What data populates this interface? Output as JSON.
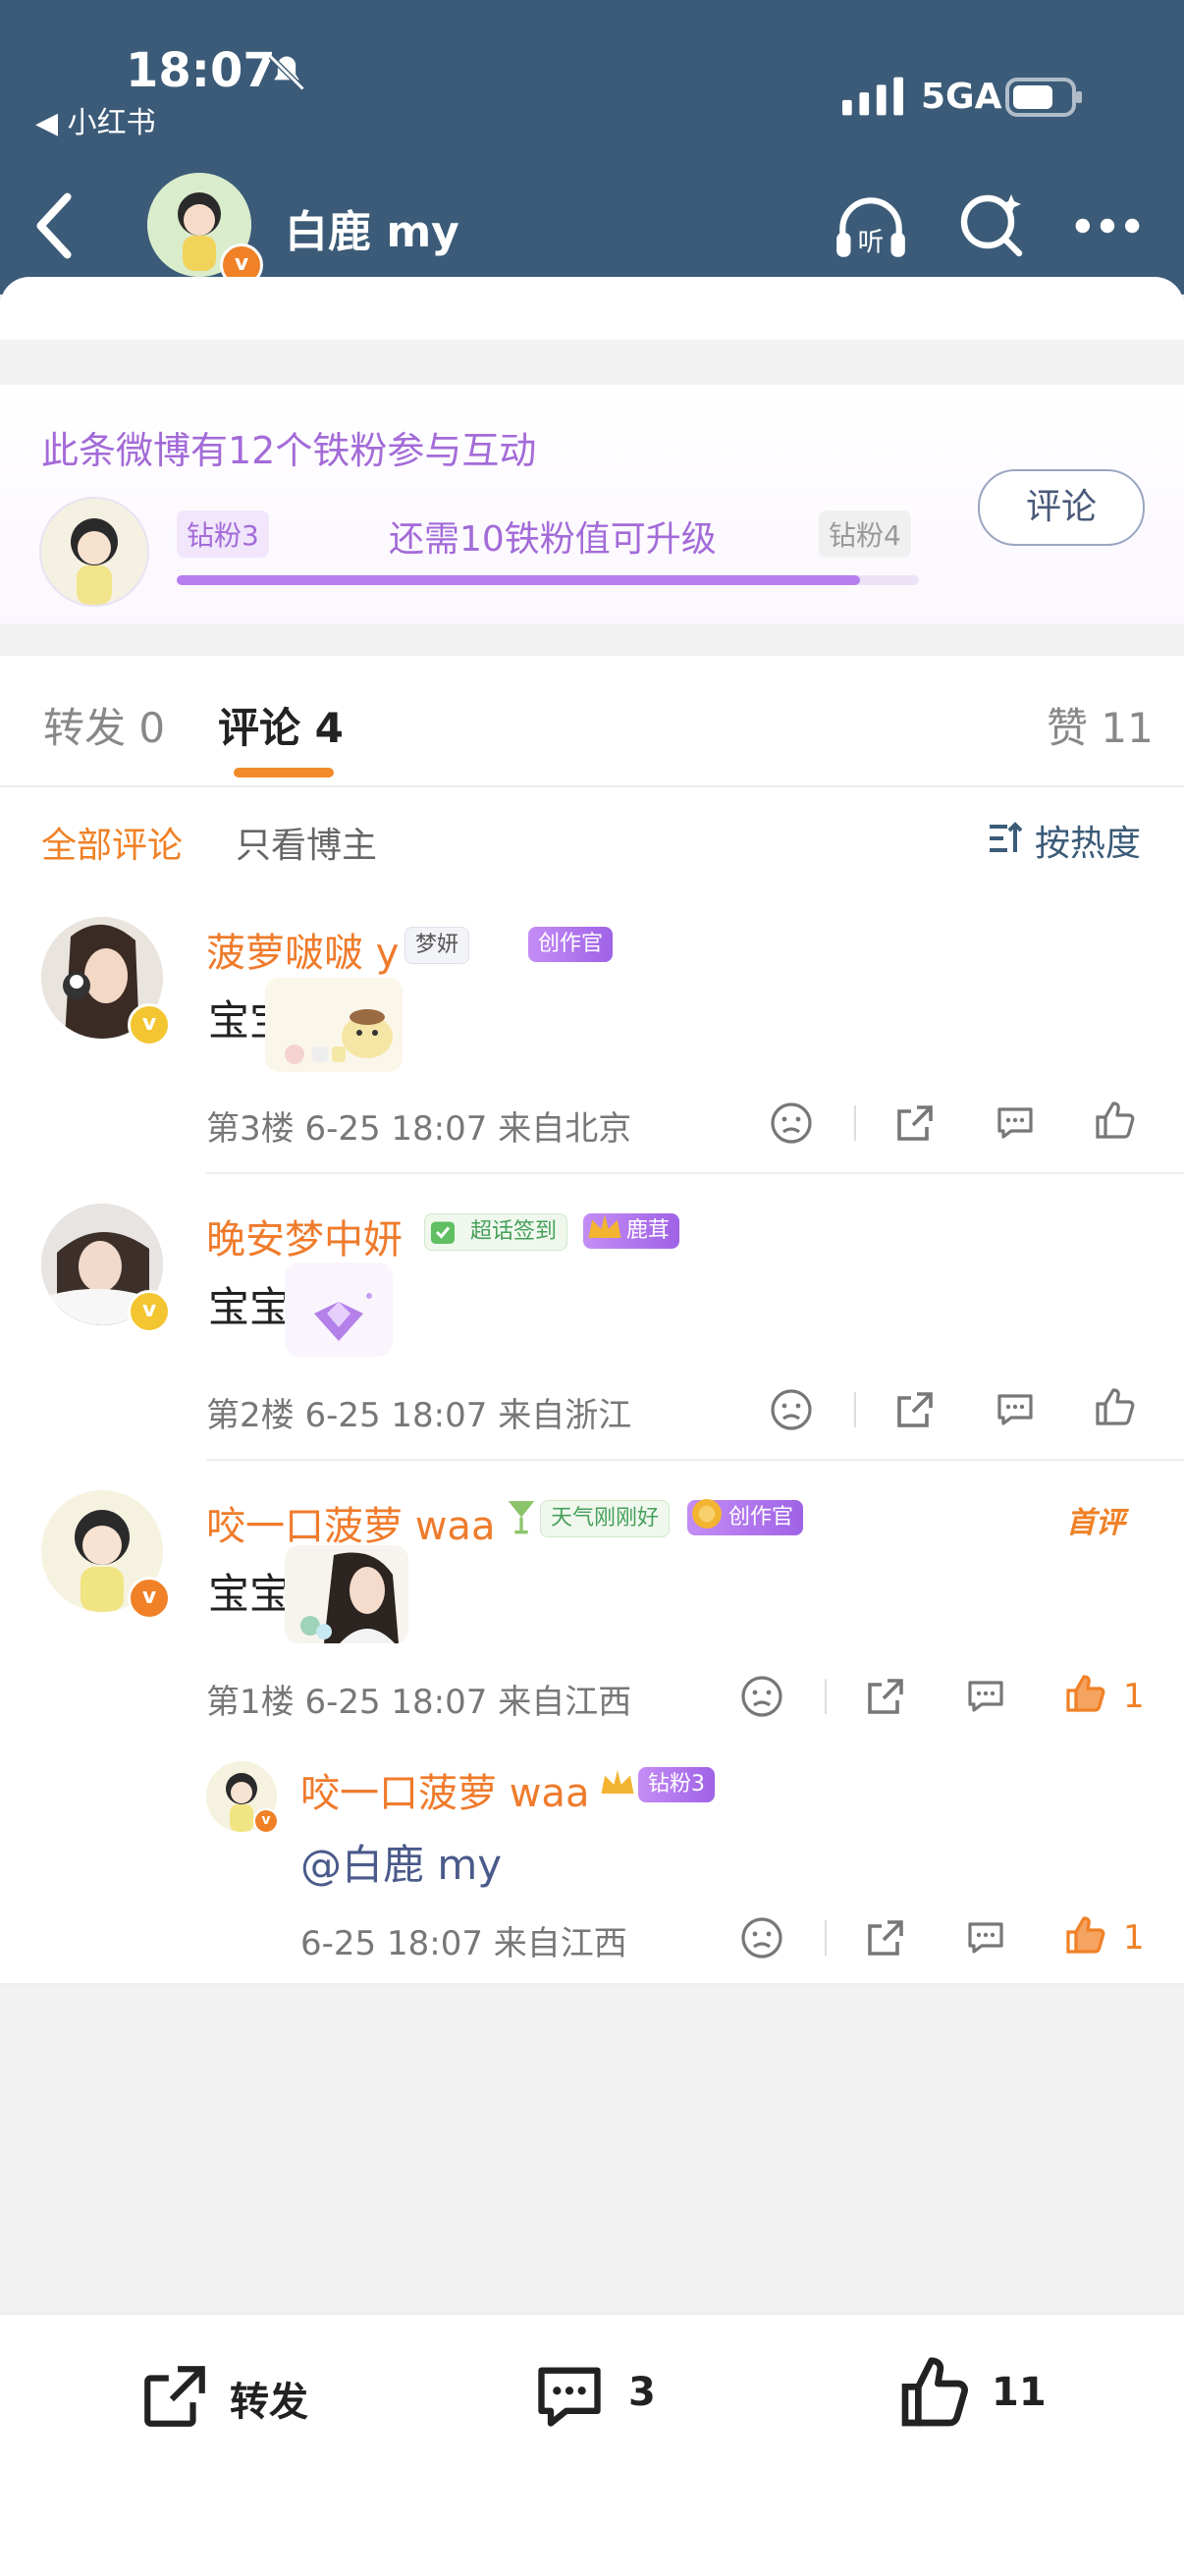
{
  "status_bar": {
    "time": "18:07",
    "back_app": "◀ 小红书",
    "network": "5GA"
  },
  "nav": {
    "title": "白鹿 my"
  },
  "fans": {
    "title": "此条微博有12个铁粉参与互动",
    "level_current": "钻粉3",
    "level_next": "钻粉4",
    "hint": "还需10铁粉值可升级",
    "progress": 0.92,
    "button": "评论"
  },
  "tabs": {
    "repost": "转发 0",
    "comments": "评论 4",
    "likes": "赞 11"
  },
  "filters": {
    "all": "全部评论",
    "owner_only": "只看博主",
    "sort": "按热度"
  },
  "comments": [
    {
      "username": "菠萝啵啵 y",
      "tags": [
        "梦妍",
        "创作官"
      ],
      "text": "宝宝",
      "meta": "第3楼 6-25 18:07 来自北京",
      "likes": ""
    },
    {
      "username": "晚安梦中妍",
      "tags": [
        "超话签到",
        "鹿茸"
      ],
      "text": "宝宝",
      "meta": "第2楼 6-25 18:07 来自浙江",
      "likes": ""
    },
    {
      "username": "咬一口菠萝 waa",
      "tags": [
        "天气刚刚好",
        "创作官"
      ],
      "badge": "首评",
      "text": "宝宝",
      "meta": "第1楼 6-25 18:07 来自江西",
      "likes": "1",
      "reply": {
        "username": "咬一口菠萝 waa",
        "tag": "钻粉3",
        "text": "@白鹿 my",
        "meta": "6-25 18:07 来自江西",
        "likes": "1"
      }
    }
  ],
  "bottom_bar": {
    "repost": "转发",
    "comments": "3",
    "likes": "11"
  },
  "colors": {
    "header": "#3b5b78",
    "accent_orange": "#f08126",
    "fans_purple": "#a36bd8"
  }
}
